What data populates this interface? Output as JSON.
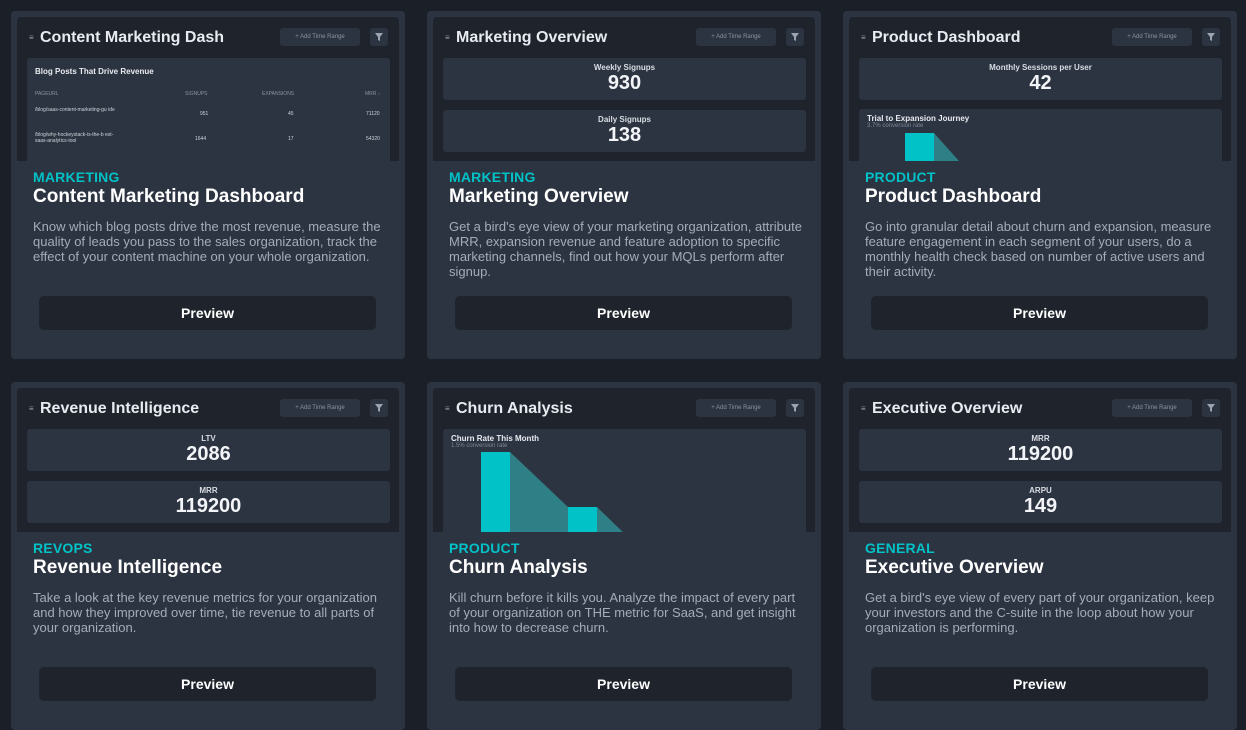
{
  "cards": [
    {
      "preview": {
        "title": "Content Marketing Dash",
        "range_label": "+ Add Time Range",
        "table": {
          "title": "Blog Posts That Drive Revenue",
          "headers": [
            "PAGEURL",
            "SIGNUPS",
            "EXPANSIONS",
            "MRR ↓"
          ],
          "rows": [
            [
              "/blog/saas-content-marketing-gu ide",
              "951",
              "45",
              "71120"
            ],
            [
              "/blog/why-hockeystack-is-the-b est-saas-analytics-tool",
              "1644",
              "17",
              "54320"
            ]
          ]
        }
      },
      "tag": "MARKETING",
      "name": "Content Marketing Dashboard",
      "description": "Know which blog posts drive the most revenue, measure the quality of leads you pass to the sales organization, track the effect of your content machine on your whole organization.",
      "button": "Preview"
    },
    {
      "preview": {
        "title": "Marketing Overview",
        "range_label": "+ Add Time Range",
        "metrics": [
          {
            "label": "Weekly Signups",
            "value": "930"
          },
          {
            "label": "Daily Signups",
            "value": "138"
          }
        ]
      },
      "tag": "MARKETING",
      "name": "Marketing Overview",
      "description": "Get a bird's eye view of your marketing organization, attribute MRR, expansion revenue and feature adoption to specific marketing channels, find out how your MQLs perform after signup.",
      "button": "Preview"
    },
    {
      "preview": {
        "title": "Product Dashboard",
        "range_label": "+ Add Time Range",
        "metrics": [
          {
            "label": "Monthly Sessions per User",
            "value": "42"
          }
        ],
        "funnel": {
          "title": "Trial to Expansion Journey",
          "subtitle": "3.7% conversion rate"
        }
      },
      "tag": "PRODUCT",
      "name": "Product Dashboard",
      "description": "Go into granular detail about churn and expansion, measure feature engagement in each segment of your users, do a monthly health check based on number of active users and their activity.",
      "button": "Preview"
    },
    {
      "preview": {
        "title": "Revenue Intelligence",
        "range_label": "+ Add Time Range",
        "metrics": [
          {
            "label": "LTV",
            "value": "2086"
          },
          {
            "label": "MRR",
            "value": "119200"
          }
        ]
      },
      "tag": "REVOPS",
      "name": "Revenue Intelligence",
      "description": "Take a look at the key revenue metrics for your organization and how they improved over time, tie revenue to all parts of your organization.",
      "button": "Preview"
    },
    {
      "preview": {
        "title": "Churn Analysis",
        "range_label": "+ Add Time Range",
        "funnel": {
          "title": "Churn Rate This Month",
          "subtitle": "1.5% conversion rate"
        }
      },
      "tag": "PRODUCT",
      "name": "Churn Analysis",
      "description": "Kill churn before it kills you. Analyze the impact of every part of your organization on THE metric for SaaS, and get insight into how to decrease churn.",
      "button": "Preview"
    },
    {
      "preview": {
        "title": "Executive Overview",
        "range_label": "+ Add Time Range",
        "metrics": [
          {
            "label": "MRR",
            "value": "119200"
          },
          {
            "label": "ARPU",
            "value": "149"
          }
        ]
      },
      "tag": "GENERAL",
      "name": "Executive Overview",
      "description": "Get a bird's eye view of every part of your organization, keep your investors and the C-suite in the loop about how your organization is performing.",
      "button": "Preview"
    }
  ],
  "colors": {
    "accent": "#00c2c7",
    "background": "#1b1f27",
    "card": "#2d3441"
  },
  "icons": {
    "menu": "menu-icon",
    "filter": "filter-icon"
  }
}
